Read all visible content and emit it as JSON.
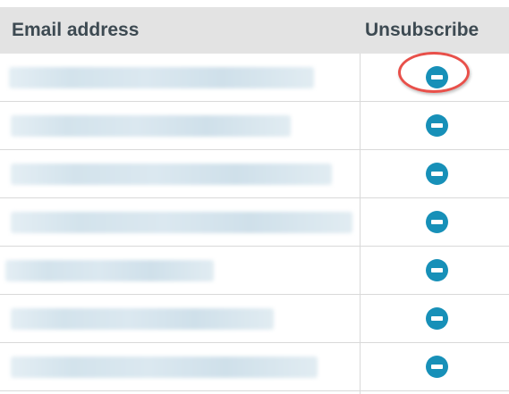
{
  "table": {
    "headers": {
      "email": "Email address",
      "unsubscribe": "Unsubscribe"
    },
    "rows": [
      {
        "email": "",
        "action_icon": "minus-circle-icon"
      },
      {
        "email": "",
        "action_icon": "minus-circle-icon"
      },
      {
        "email": "",
        "action_icon": "minus-circle-icon"
      },
      {
        "email": "",
        "action_icon": "minus-circle-icon"
      },
      {
        "email": "",
        "action_icon": "minus-circle-icon"
      },
      {
        "email": "",
        "action_icon": "minus-circle-icon"
      },
      {
        "email": "",
        "action_icon": "minus-circle-icon"
      }
    ]
  },
  "colors": {
    "header_bg": "#e3e3e3",
    "header_text": "#3d4a52",
    "icon": "#1790b8",
    "highlight": "#e8504a"
  }
}
